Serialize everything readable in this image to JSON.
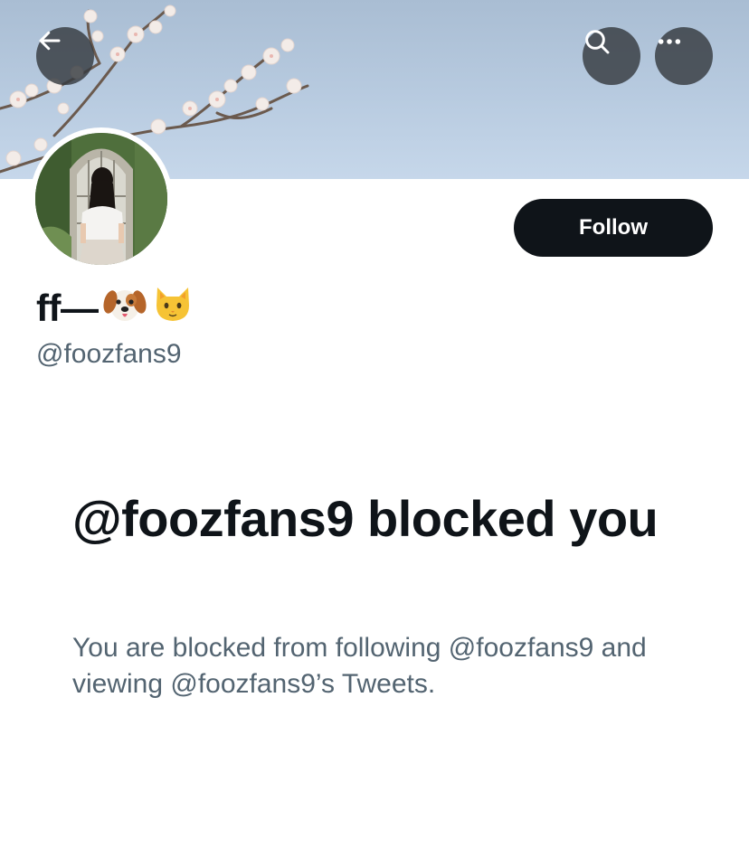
{
  "profile": {
    "display_name": "ff—",
    "emoji": [
      "dog-face",
      "cat-face"
    ],
    "handle": "@foozfans9"
  },
  "header": {
    "back_icon": "arrow-left-icon",
    "search_icon": "search-icon",
    "more_icon": "more-horizontal-icon"
  },
  "actions": {
    "follow_label": "Follow"
  },
  "blocked": {
    "title": "@foozfans9 blocked you",
    "description": "You are blocked from following @foozfans9 and viewing @foozfans9’s Tweets."
  },
  "colors": {
    "text_primary": "#0f1419",
    "text_secondary": "#536471",
    "button_dark": "#0f1419",
    "banner_sky": "#b8cbe0"
  }
}
